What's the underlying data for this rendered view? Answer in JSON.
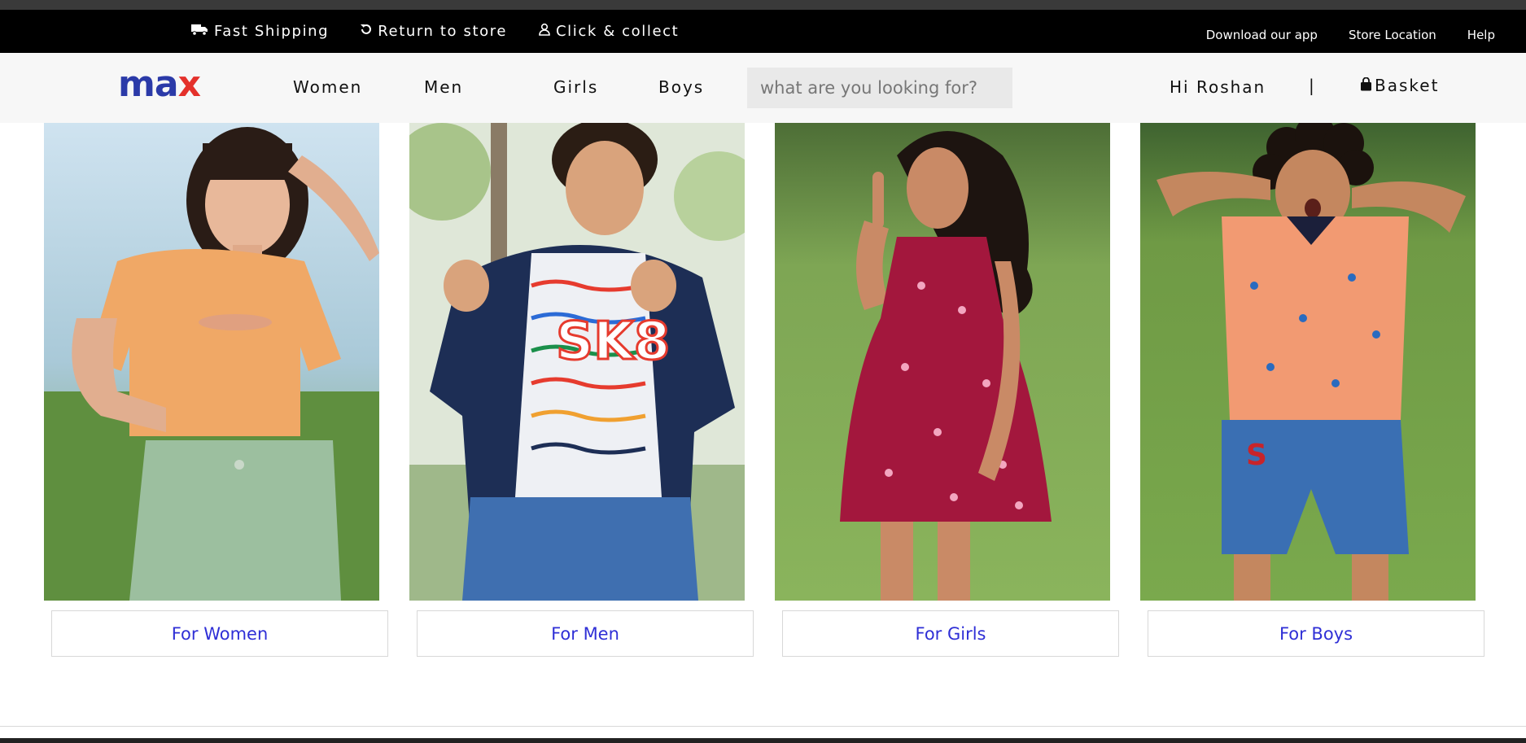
{
  "promo_bar": {
    "fast_shipping": "Fast Shipping",
    "return_to_store": "Return to store",
    "click_collect": "Click & collect",
    "download_app": "Download our app",
    "store_location": "Store Location",
    "help": "Help"
  },
  "header": {
    "logo_m": "m",
    "logo_a": "a",
    "logo_x": "x",
    "nav": {
      "women": "Women",
      "men": "Men",
      "girls": "Girls",
      "boys": "Boys"
    },
    "search_placeholder": "what are you looking for?",
    "greeting": "Hi Roshan",
    "separator": "|",
    "basket": "Basket"
  },
  "categories": [
    {
      "label": "For Women",
      "image": "woman-in-orange-top"
    },
    {
      "label": "For Men",
      "image": "man-in-printed-tshirt"
    },
    {
      "label": "For Girls",
      "image": "girl-in-red-floral-dress"
    },
    {
      "label": "For Boys",
      "image": "boy-in-orange-polo"
    }
  ],
  "colors": {
    "promo_bg": "#000000",
    "nav_bg": "#f7f7f7",
    "logo_blue": "#2b3aa8",
    "logo_red": "#e4312b",
    "category_link": "#2f2fd6"
  }
}
